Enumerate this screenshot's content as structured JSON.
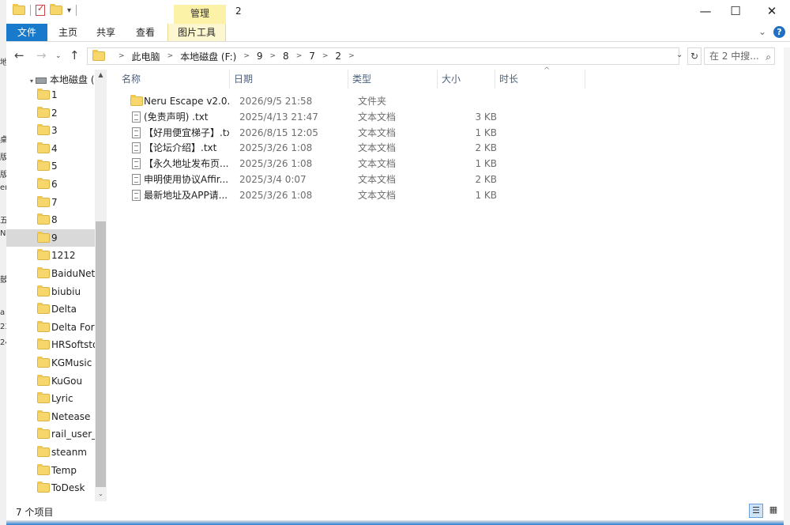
{
  "window": {
    "title": "2",
    "manage_tab": "管理",
    "controls": {
      "minimize": "—",
      "maximize": "☐",
      "close": "✕"
    }
  },
  "ribbon": {
    "tabs": [
      "文件",
      "主页",
      "共享",
      "查看",
      "图片工具"
    ],
    "help": "?"
  },
  "address": {
    "crumbs": [
      "此电脑",
      "本地磁盘 (F:)",
      "9",
      "8",
      "7",
      "2"
    ],
    "search_placeholder": "在 2 中搜..."
  },
  "nav": {
    "drive_label": "本地磁盘 (F:)",
    "items": [
      "1",
      "2",
      "3",
      "4",
      "5",
      "6",
      "7",
      "8",
      "9",
      "1212",
      "BaiduNetd",
      "biubiu",
      "Delta",
      "Delta Forc",
      "HRSoftsto",
      "KGMusic",
      "KuGou",
      "Lyric",
      "Netease",
      "rail_user_d",
      "steanm",
      "Temp",
      "ToDesk"
    ],
    "selected_index": 8
  },
  "columns": [
    "名称",
    "日期",
    "类型",
    "大小",
    "时长"
  ],
  "files": [
    {
      "name": "Neru Escape v2.0...",
      "date": "2026/9/5 21:58",
      "type": "文件夹",
      "size": "",
      "icon": "folder-icon"
    },
    {
      "name": "(免责声明) .txt",
      "date": "2025/4/13 21:47",
      "type": "文本文档",
      "size": "3 KB",
      "icon": "text-file-icon"
    },
    {
      "name": "【好用便宜梯子】.txt",
      "date": "2026/8/15 12:05",
      "type": "文本文档",
      "size": "1 KB",
      "icon": "text-file-icon"
    },
    {
      "name": "【论坛介绍】.txt",
      "date": "2025/3/26 1:08",
      "type": "文本文档",
      "size": "2 KB",
      "icon": "text-file-icon"
    },
    {
      "name": "【永久地址发布页...",
      "date": "2025/3/26 1:08",
      "type": "文本文档",
      "size": "1 KB",
      "icon": "text-file-icon"
    },
    {
      "name": "申明使用协议Affir...",
      "date": "2025/3/4 0:07",
      "type": "文本文档",
      "size": "2 KB",
      "icon": "text-file-icon"
    },
    {
      "name": "最新地址及APP请...",
      "date": "2025/3/26 1:08",
      "type": "文本文档",
      "size": "1 KB",
      "icon": "text-file-icon"
    }
  ],
  "status": {
    "count_text": "7 个项目"
  },
  "colors": {
    "file_tab": "#1979ca",
    "manage_tab": "#fbf1a7",
    "selected_row": "#d9d9d9",
    "column_header": "#4c607a"
  }
}
